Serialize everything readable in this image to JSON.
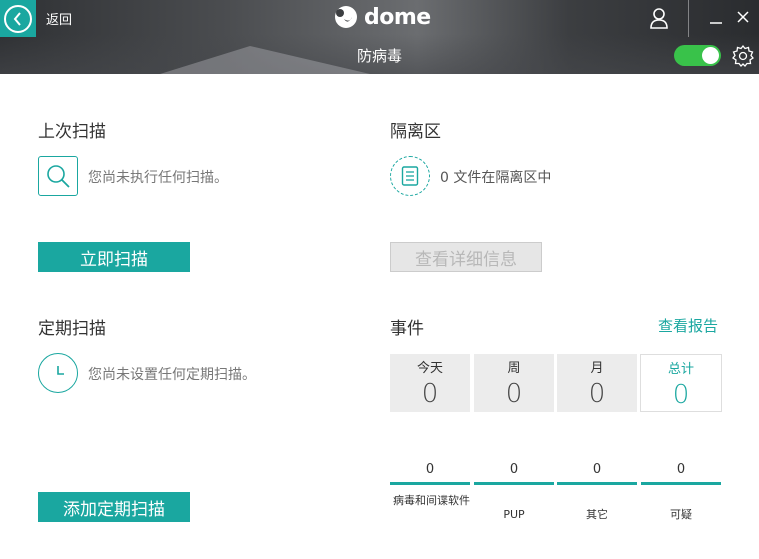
{
  "header": {
    "back_label": "返回",
    "logo_text": "dome",
    "page_title": "防病毒",
    "protection_enabled": true
  },
  "last_scan": {
    "title": "上次扫描",
    "message": "您尚未执行任何扫描。",
    "button": "立即扫描"
  },
  "quarantine": {
    "title": "隔离区",
    "message": "0 文件在隔离区中",
    "button": "查看详细信息"
  },
  "scheduled_scan": {
    "title": "定期扫描",
    "message": "您尚未设置任何定期扫描。",
    "button": "添加定期扫描"
  },
  "events": {
    "title": "事件",
    "report_link": "查看报告",
    "periods": [
      {
        "label": "今天",
        "value": "0"
      },
      {
        "label": "周",
        "value": "0"
      },
      {
        "label": "月",
        "value": "0"
      },
      {
        "label": "总计",
        "value": "0"
      }
    ],
    "categories": [
      {
        "label": "病毒和间谍软件",
        "count": "0"
      },
      {
        "label": "PUP",
        "count": "0"
      },
      {
        "label": "其它",
        "count": "0"
      },
      {
        "label": "可疑",
        "count": "0"
      }
    ]
  },
  "colors": {
    "accent": "#1aa7a0",
    "toggle_on": "#39c24a"
  }
}
